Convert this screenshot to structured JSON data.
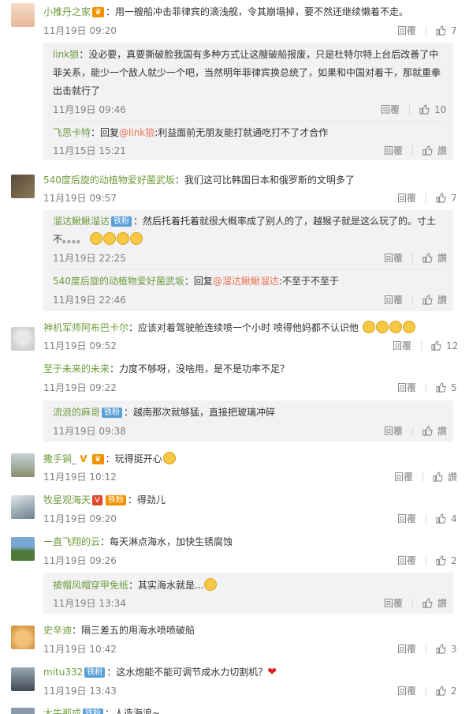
{
  "actions": {
    "reply_label": "回覆",
    "like_label": "讚"
  },
  "comments": [
    {
      "user": "小推丹之家",
      "text": "：用一艘船冲击菲律宾的滴浅舰，令其崩塌掉，要不然还继续懒着不走。",
      "time": "11月19日 09:20",
      "likes": "7"
    },
    {
      "user": "link狼",
      "text": "：没必要，真要撕破脸我国有多种方式让这艘破船报废，只是杜特尔特上台后改善了中菲关系，能少一个敌人就少一个吧，当然明年菲律宾换总统了，如果和中国对着干，那就重拳出击就行了",
      "time": "11月19日 09:46",
      "likes": "10"
    },
    {
      "user": "飞思卡特",
      "reply_prefix": "：回复",
      "reply_to": "@link狼",
      "text": ":利益面前无朋友能打就通吃打不了才合作",
      "time": "11月15日 15:21"
    },
    {
      "user": "540度后旋的动植物爱好菌武坂",
      "text": "：我们这可比韩国日本和俄罗斯的文明多了",
      "time": "11月19日 09:57",
      "likes": "7"
    },
    {
      "user": "溜达鰍鰍溜达",
      "badge": "铁粉",
      "text": "：然后托着托着就很大概率成了别人的了，越猴子就是这么玩了的。寸土不。。。。",
      "time": "11月19日 22:25"
    },
    {
      "user": "540度后旋的动植物爱好菌武坂",
      "reply_prefix": "：回复",
      "reply_to": "@溜达鰍鰍溜达",
      "text": ":不至于不至于",
      "time": "11月19日 22:46"
    },
    {
      "user": "神机军师阿布巴卡尔",
      "text": "：应该对着驾驶舱连续喷一个小时 喷得他妈都不认识他",
      "time": "11月19日 09:52",
      "likes": "12"
    },
    {
      "user": "至于未来的未来",
      "text": "：力度不够呀，没啥用，是不是功率不足？",
      "time": "11月19日 09:22",
      "likes": "5"
    },
    {
      "user": "流浪的麻哥",
      "badge": "铁粉",
      "text": "：越南那次就够猛，直接把玻璃冲碎",
      "time": "11月19日 09:38"
    },
    {
      "user": "撒手锏_",
      "text": "：玩得挺开心",
      "time": "11月19日 10:12"
    },
    {
      "user": "牧星观海天",
      "badge": "铁粉",
      "text": "：得劲儿",
      "time": "11月19日 09:20",
      "likes": "4"
    },
    {
      "user": "一直飞翔的云",
      "text": "：每天淋点海水，加快生锈腐蚀",
      "time": "11月19日 09:26",
      "likes": "2"
    },
    {
      "user": "被帽风帽穿甲免纸",
      "text": "：其实海水就是...",
      "time": "11月19日 13:34"
    },
    {
      "user": "史辛迪",
      "text": "：隔三差五的用海水喷喷破船",
      "time": "11月19日 10:42",
      "likes": "3"
    },
    {
      "user": "mitu332",
      "badge": "铁粉",
      "text": "：这水炮能不能可调节成水力切割机？",
      "time": "11月19日 13:43",
      "likes": "2"
    },
    {
      "user": "大牛那成",
      "badge": "铁粉",
      "text": "：人造海浪~"
    }
  ]
}
